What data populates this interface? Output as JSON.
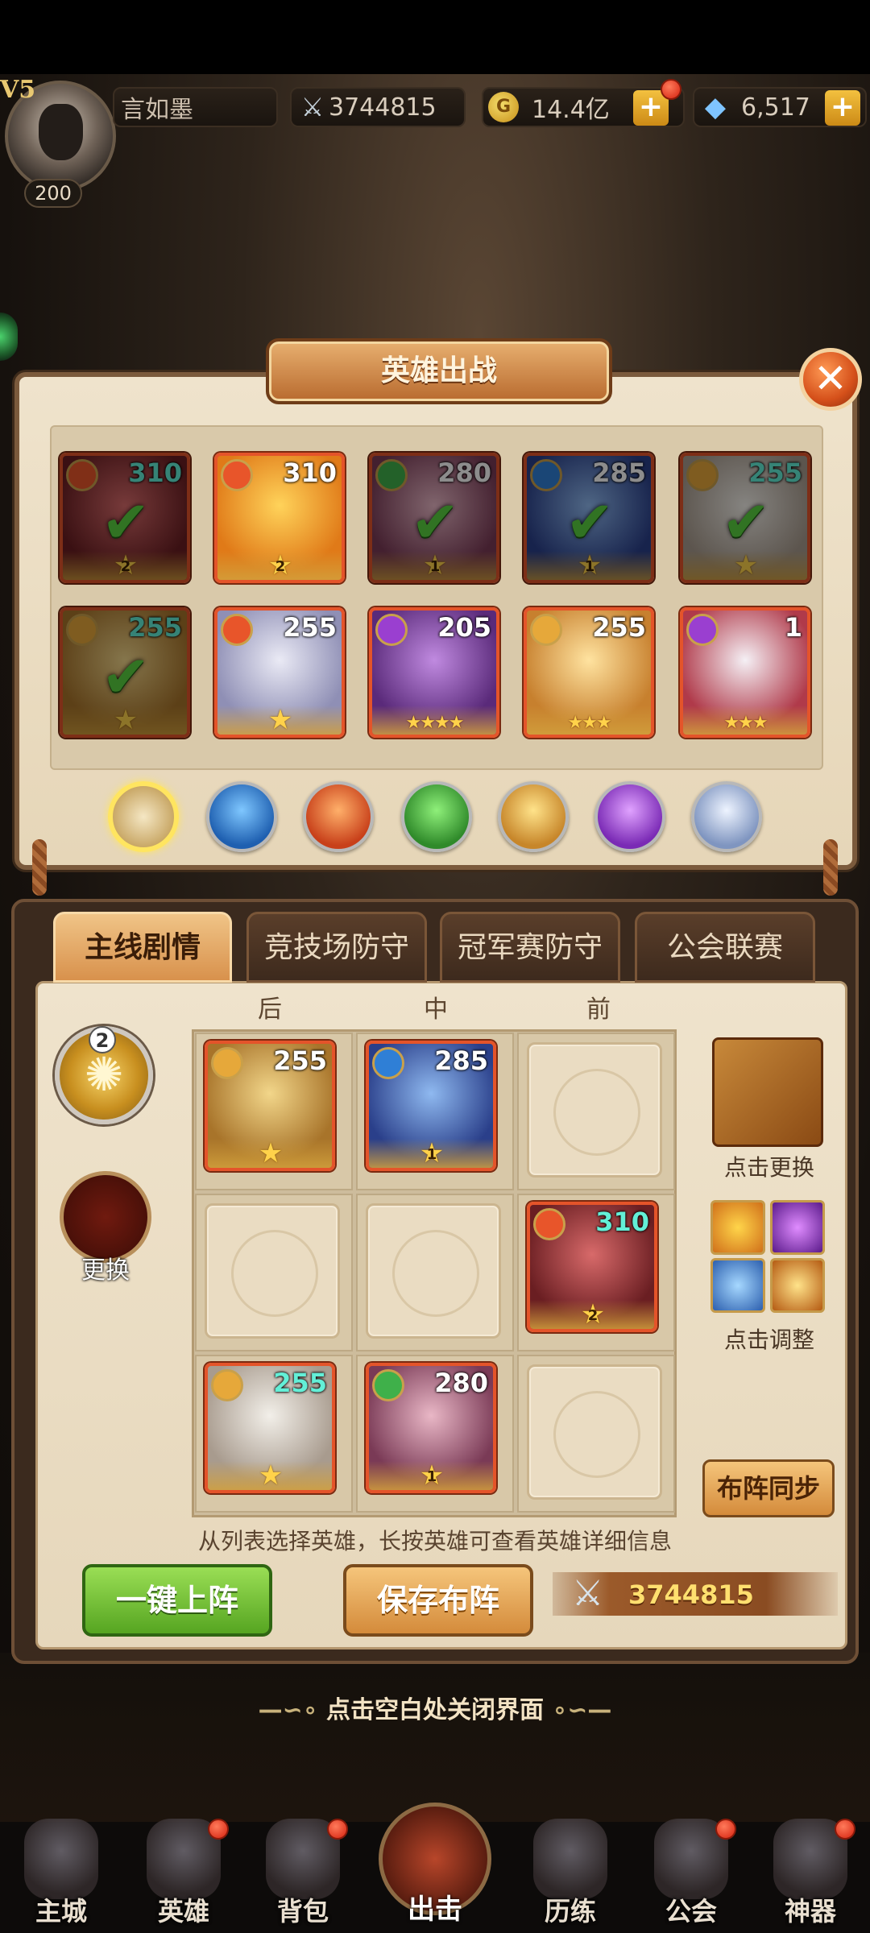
{
  "player": {
    "vip": "V5",
    "level": "200",
    "name": "言如墨",
    "power": "3744815",
    "gold": "14.4亿",
    "gems": "6,517"
  },
  "panel_title": "英雄出战",
  "hero_roster": [
    {
      "level": "310",
      "stars": "2",
      "element": "fire",
      "deployed": true
    },
    {
      "level": "310",
      "stars": "2",
      "element": "fire",
      "deployed": false
    },
    {
      "level": "280",
      "stars": "1",
      "element": "wind",
      "deployed": true
    },
    {
      "level": "285",
      "stars": "1",
      "element": "water",
      "deployed": true
    },
    {
      "level": "255",
      "stars": "",
      "element": "light",
      "deployed": true
    },
    {
      "level": "255",
      "stars": "",
      "element": "light",
      "deployed": true
    },
    {
      "level": "255",
      "stars": "",
      "element": "fire",
      "deployed": false
    },
    {
      "level": "205",
      "stars": "★★★★",
      "element": "dark",
      "deployed": false
    },
    {
      "level": "255",
      "stars": "★★★",
      "element": "light",
      "deployed": false
    },
    {
      "level": "1",
      "stars": "★★★",
      "element": "dark",
      "deployed": false
    }
  ],
  "element_filters": [
    "all",
    "water",
    "fire",
    "wind",
    "light",
    "dark",
    "void"
  ],
  "tabs": [
    "主线剧情",
    "竞技场防守",
    "冠军赛防守",
    "公会联赛"
  ],
  "columns": [
    "后",
    "中",
    "前"
  ],
  "formation": {
    "element_count": "2",
    "change_label": "更换",
    "slots": [
      {
        "level": "255",
        "stars": "",
        "element": "light"
      },
      {
        "level": "285",
        "stars": "1",
        "element": "water"
      },
      null,
      null,
      null,
      {
        "level": "310",
        "stars": "2",
        "element": "fire"
      },
      {
        "level": "255",
        "stars": "",
        "element": "light"
      },
      {
        "level": "280",
        "stars": "1",
        "element": "wind"
      },
      null
    ]
  },
  "artifact_label": "点击更换",
  "skills_label": "点击调整",
  "sync_button": "布阵同步",
  "hint_text": "从列表选择英雄，长按英雄可查看英雄详细信息",
  "auto_button": "一键上阵",
  "save_button": "保存布阵",
  "team_power": "3744815",
  "close_hint": "点击空白处关闭界面",
  "nav": [
    {
      "label": "主城"
    },
    {
      "label": "英雄"
    },
    {
      "label": "背包"
    },
    {
      "label": "出击"
    },
    {
      "label": "历练"
    },
    {
      "label": "公会"
    },
    {
      "label": "神器"
    }
  ],
  "colors": {
    "fire": "#e8552a",
    "water": "#2f7fd6",
    "wind": "#3fb04a",
    "light": "#e6a83a",
    "dark": "#9a3fd0",
    "void": "#9fb4d8"
  }
}
